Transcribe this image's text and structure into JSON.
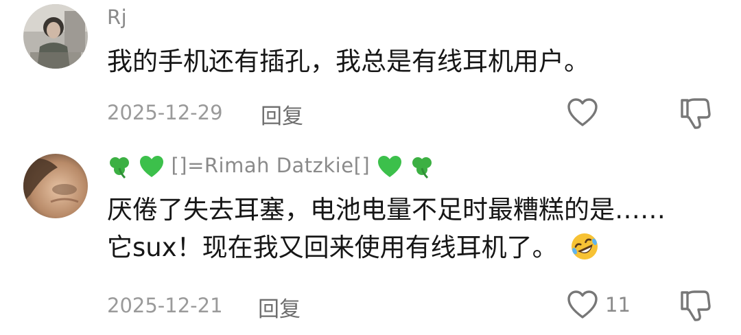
{
  "comments": [
    {
      "username": "Rj",
      "text_lines": [
        "我的手机还有插孔，我总是有线耳机用户。"
      ],
      "date": "2025-12-29",
      "reply_label": "回复",
      "like_count": ""
    },
    {
      "username_prefix_icons": [
        "shamrock-emoji",
        "green-heart-emoji"
      ],
      "username": "[]=Rimah Datzkie[]",
      "username_suffix_icons": [
        "green-heart-emoji",
        "shamrock-emoji"
      ],
      "text_lines": [
        "厌倦了失去耳塞，电池电量不足时最糟糕的是……",
        "它sux！现在我又回来使用有线耳机了。"
      ],
      "text_trailing_icon": "rofl-emoji",
      "date": "2025-12-21",
      "reply_label": "回复",
      "like_count": "11"
    }
  ],
  "colors": {
    "text": "#161616",
    "meta": "#9a9a9a",
    "icon": "#777777",
    "emoji_green": "#3cb043",
    "emoji_yellow": "#f7c234"
  }
}
